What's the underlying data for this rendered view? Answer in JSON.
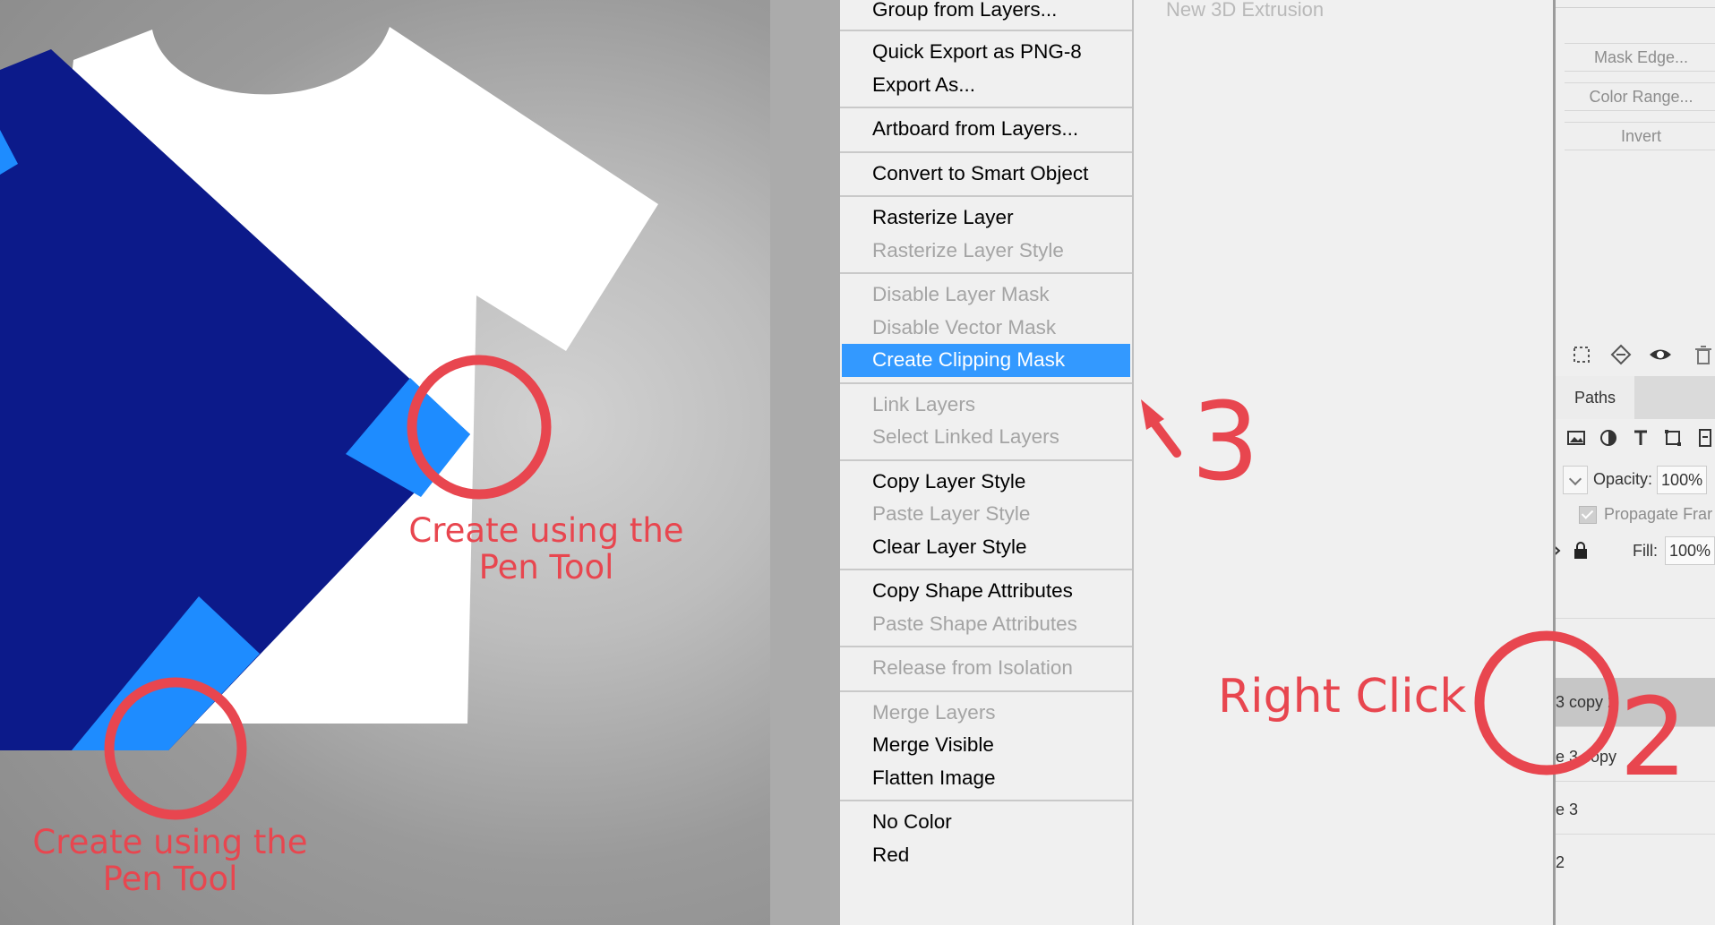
{
  "context_menu": {
    "groups": [
      [
        {
          "label": "Group from Layers...",
          "enabled": true
        }
      ],
      [
        {
          "label": "Quick Export as PNG-8",
          "enabled": true
        },
        {
          "label": "Export As...",
          "enabled": true
        }
      ],
      [
        {
          "label": "Artboard from Layers...",
          "enabled": true
        }
      ],
      [
        {
          "label": "Convert to Smart Object",
          "enabled": true
        }
      ],
      [
        {
          "label": "Rasterize Layer",
          "enabled": true
        },
        {
          "label": "Rasterize Layer Style",
          "enabled": false
        }
      ],
      [
        {
          "label": "Disable Layer Mask",
          "enabled": false
        },
        {
          "label": "Disable Vector Mask",
          "enabled": false
        },
        {
          "label": "Create Clipping Mask",
          "enabled": true,
          "highlighted": true
        }
      ],
      [
        {
          "label": "Link Layers",
          "enabled": false
        },
        {
          "label": "Select Linked Layers",
          "enabled": false
        }
      ],
      [
        {
          "label": "Copy Layer Style",
          "enabled": true
        },
        {
          "label": "Paste Layer Style",
          "enabled": false
        },
        {
          "label": "Clear Layer Style",
          "enabled": true
        }
      ],
      [
        {
          "label": "Copy Shape Attributes",
          "enabled": true
        },
        {
          "label": "Paste Shape Attributes",
          "enabled": false
        }
      ],
      [
        {
          "label": "Release from Isolation",
          "enabled": false
        }
      ],
      [
        {
          "label": "Merge Layers",
          "enabled": false
        },
        {
          "label": "Merge Visible",
          "enabled": true
        },
        {
          "label": "Flatten Image",
          "enabled": true
        }
      ],
      [
        {
          "label": "No Color",
          "enabled": true
        },
        {
          "label": "Red",
          "enabled": true
        }
      ]
    ]
  },
  "submenu": {
    "item": "New 3D Extrusion"
  },
  "panel": {
    "buttons": {
      "mask_edge": "Mask Edge...",
      "color_range": "Color Range...",
      "invert": "Invert"
    },
    "tab_paths": "Paths",
    "opacity_label": "Opacity:",
    "opacity_value": "100%",
    "propagate_label": "Propagate Frar",
    "fill_label": "Fill:",
    "fill_value": "100%",
    "layers": [
      "3 copy 2",
      "e 3 copy",
      "e 3",
      "2"
    ]
  },
  "annotations": {
    "pen_tool_1": {
      "line1": "Create using the",
      "line2": "Pen Tool"
    },
    "pen_tool_2": {
      "line1": "Create using the",
      "line2": "Pen Tool"
    },
    "right_click": "Right Click",
    "step_2": "2",
    "step_3": "3"
  },
  "colors": {
    "accent_red": "#e8464f",
    "shirt_white": "#ffffff",
    "shape_navy": "#0c1a8a",
    "shape_blue": "#1e8cff",
    "menu_highlight": "#3399ff"
  }
}
